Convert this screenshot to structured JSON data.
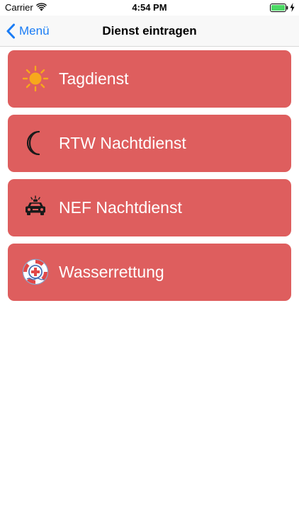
{
  "status_bar": {
    "carrier": "Carrier",
    "time": "4:54 PM",
    "battery_color": "#4cd964"
  },
  "nav": {
    "back_label": "Menü",
    "title": "Dienst eintragen",
    "tint_color": "#1a7cf5"
  },
  "duties": [
    {
      "label": "Tagdienst",
      "icon": "sun-icon"
    },
    {
      "label": "RTW Nachtdienst",
      "icon": "moon-icon"
    },
    {
      "label": "NEF Nachtdienst",
      "icon": "emergency-car-icon"
    },
    {
      "label": "Wasserrettung",
      "icon": "lifebuoy-icon"
    }
  ],
  "colors": {
    "card_background": "#de5e5e",
    "card_text": "#ffffff"
  }
}
